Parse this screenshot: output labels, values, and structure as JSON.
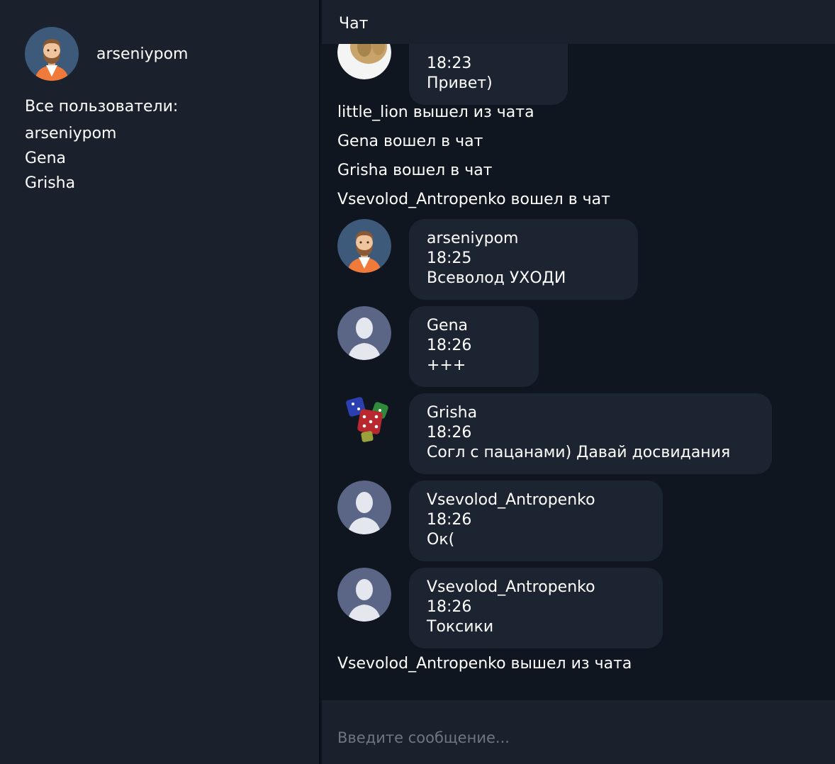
{
  "current_user": {
    "name": "arseniypom",
    "avatar_icon": "bearded-man-avatar-icon"
  },
  "users": {
    "title": "Все пользователи:",
    "list": [
      "arseniypom",
      "Gena",
      "Grisha"
    ]
  },
  "chat": {
    "title": "Чат",
    "top_partial_message": {
      "time": "18:23",
      "text": "Привет)",
      "avatar_icon": "lion-avatar-icon"
    },
    "events": [
      "little_lion вышел из чата",
      "Gena вошел в чат",
      "Grisha вошел в чат",
      "Vsevolod_Antropenko вошел в чат"
    ],
    "messages": [
      {
        "author": "arseniypom",
        "time": "18:25",
        "text": "Всеволод УХОДИ",
        "avatar_icon": "bearded-man-avatar-icon"
      },
      {
        "author": "Gena",
        "time": "18:26",
        "text": "+++",
        "avatar_icon": "default-user-avatar-icon"
      },
      {
        "author": "Grisha",
        "time": "18:26",
        "text": "Согл с пацанами) Давай досвидания",
        "avatar_icon": "dice-avatar-icon"
      },
      {
        "author": "Vsevolod_Antropenko",
        "time": "18:26",
        "text": "Ок(",
        "avatar_icon": "default-user-avatar-icon"
      },
      {
        "author": "Vsevolod_Antropenko",
        "time": "18:26",
        "text": "Токсики",
        "avatar_icon": "default-user-avatar-icon"
      }
    ],
    "final_event": "Vsevolod_Antropenko вышел из чата"
  },
  "input": {
    "placeholder": "Введите сообщение...",
    "value": ""
  },
  "colors": {
    "sidebar_bg": "#1a212c",
    "chat_bg": "#10161f",
    "bubble_bg": "#1c2431",
    "default_avatar_bg": "#5b6687",
    "user_avatar_bg": "#3d5a7a"
  }
}
